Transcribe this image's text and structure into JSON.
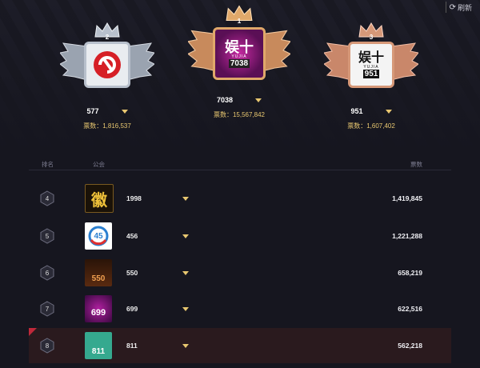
{
  "header": {
    "refresh_label": "刷新"
  },
  "podium": [
    {
      "rank": "2",
      "name": "577",
      "votes_label": "票数：",
      "votes": "1,816,537",
      "logo_text": ""
    },
    {
      "rank": "1",
      "name": "7038",
      "votes_label": "票数：",
      "votes": "15,567,842",
      "logo_text": "娱十",
      "logo_sub": "YUJIA",
      "logo_num": "7038"
    },
    {
      "rank": "3",
      "name": "951",
      "votes_label": "票数：",
      "votes": "1,607,402",
      "logo_text": "娱十",
      "logo_sub": "YUJIA",
      "logo_num": "951"
    }
  ],
  "table": {
    "headers": {
      "rank": "排名",
      "guild": "公会",
      "votes": "票数"
    },
    "rows": [
      {
        "rank": "4",
        "name": "1998",
        "votes": "1,419,845",
        "logo_text": "徽"
      },
      {
        "rank": "5",
        "name": "456",
        "votes": "1,221,288",
        "logo_text": "45"
      },
      {
        "rank": "6",
        "name": "550",
        "votes": "658,219",
        "logo_text": "550"
      },
      {
        "rank": "7",
        "name": "699",
        "votes": "622,516",
        "logo_text": "699"
      },
      {
        "rank": "8",
        "name": "811",
        "votes": "562,218",
        "logo_text": "811"
      }
    ]
  }
}
